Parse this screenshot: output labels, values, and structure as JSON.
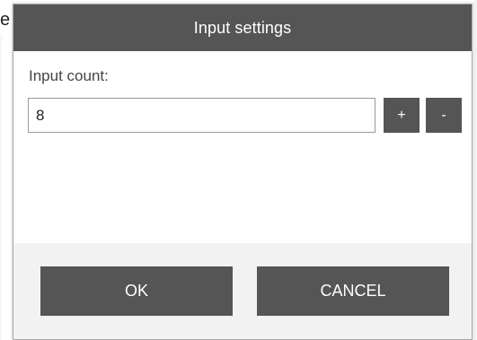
{
  "background": {
    "fragment_text": "e"
  },
  "dialog": {
    "title": "Input settings",
    "field_label": "Input count:",
    "input_value": "8",
    "increment_label": "+",
    "decrement_label": "-",
    "ok_label": "OK",
    "cancel_label": "CANCEL"
  },
  "colors": {
    "titlebar": "#555555",
    "button": "#555555",
    "button_text": "#ffffff",
    "footer": "#f2f2f2"
  }
}
